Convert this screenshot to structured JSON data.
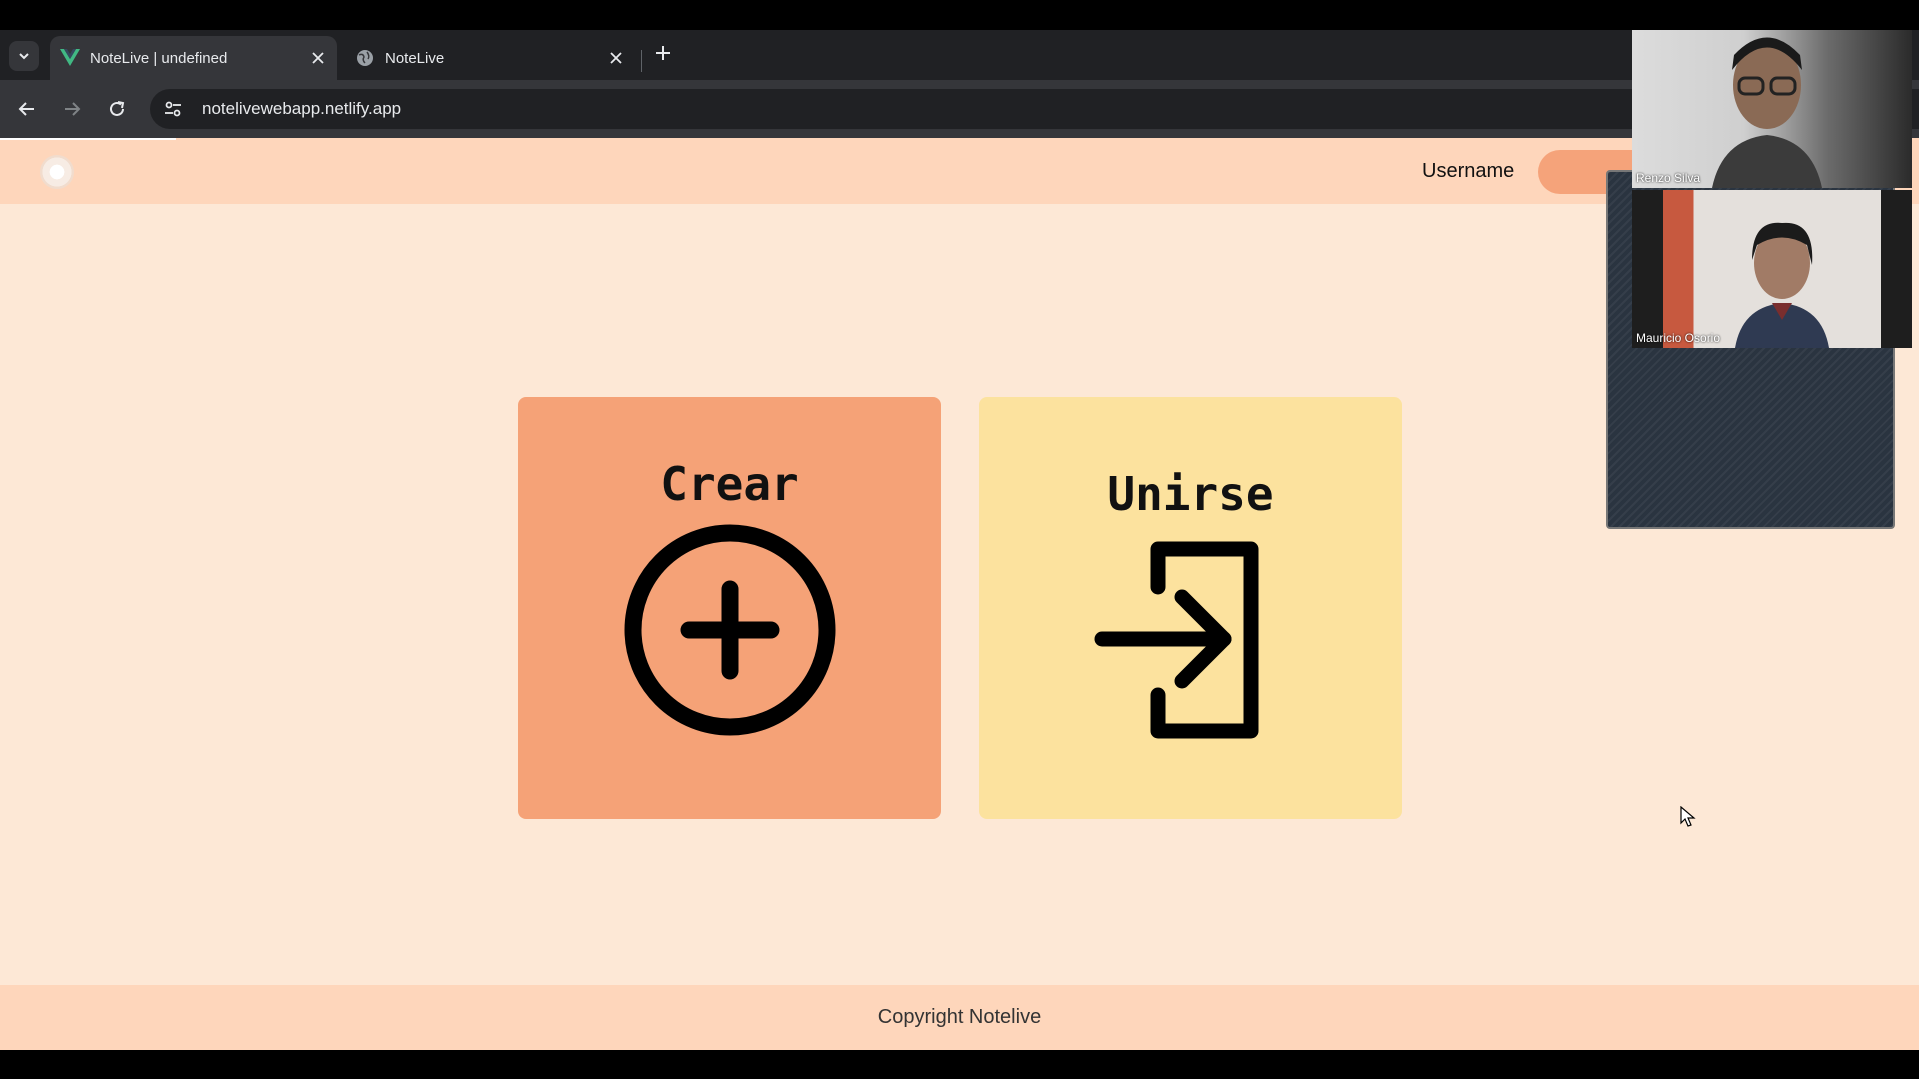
{
  "browser": {
    "tabs": [
      {
        "title": "NoteLive | undefined",
        "favicon": "vue-logo-icon",
        "active": true
      },
      {
        "title": "NoteLive",
        "favicon": "globe-icon",
        "active": false
      }
    ],
    "url": "notelivewebapp.netlify.app"
  },
  "page": {
    "navbar": {
      "username": "Username"
    },
    "cards": {
      "crear": {
        "title": "Crear",
        "icon": "add-circle-icon",
        "color": "#f5a277"
      },
      "unirse": {
        "title": "Unirse",
        "icon": "login-icon",
        "color": "#fce29e"
      }
    },
    "footer": {
      "text": "Copyright Notelive"
    },
    "colors": {
      "background": "#fde8d6",
      "navbar": "#fed6bb",
      "accent": "#f5a37a"
    }
  },
  "video_call": {
    "participants": [
      {
        "name": "Renzo Silva"
      },
      {
        "name": "Mauricio Osorio"
      }
    ]
  }
}
